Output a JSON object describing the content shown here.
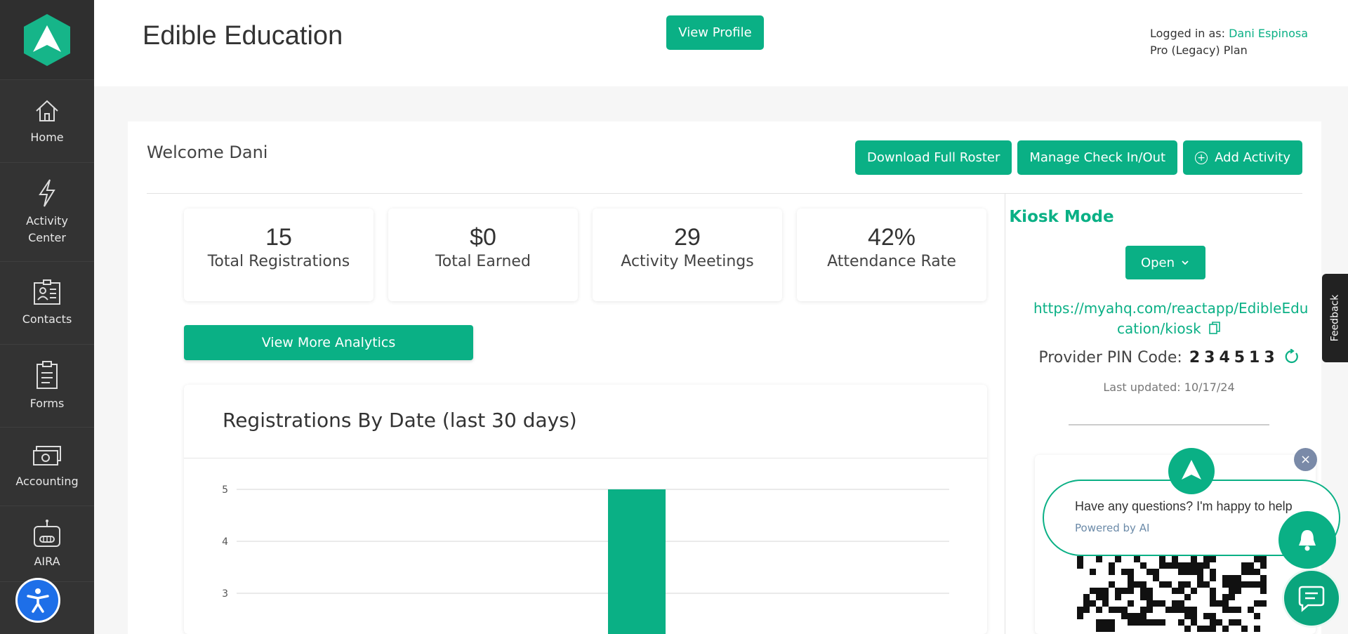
{
  "sidebar": {
    "items": [
      {
        "label": "Home",
        "icon": "home-icon"
      },
      {
        "label": "Activity\nCenter",
        "icon": "lightning-icon"
      },
      {
        "label": "Contacts",
        "icon": "contact-card-icon"
      },
      {
        "label": "Forms",
        "icon": "clipboard-icon"
      },
      {
        "label": "Accounting",
        "icon": "money-icon"
      },
      {
        "label": "AIRA",
        "icon": "robot-icon"
      }
    ]
  },
  "header": {
    "title": "Edible Education",
    "view_profile": "View Profile",
    "logged_in_prefix": "Logged in as: ",
    "user_name": "Dani Espinosa",
    "plan": "Pro (Legacy) Plan"
  },
  "main": {
    "welcome": "Welcome Dani",
    "buttons": {
      "download": "Download Full Roster",
      "manage": "Manage Check In/Out",
      "add": "Add Activity"
    },
    "stats": [
      {
        "value": "15",
        "label": "Total Registrations"
      },
      {
        "value": "$0",
        "label": "Total Earned"
      },
      {
        "value": "29",
        "label": "Activity Meetings"
      },
      {
        "value": "42%",
        "label": "Attendance Rate"
      }
    ],
    "analytics_button": "View More Analytics",
    "chart_title": "Registrations By Date (last 30 days)"
  },
  "kiosk": {
    "title": "Kiosk Mode",
    "open_label": "Open",
    "url_line1": "https://myahq.com/reactapp/EdibleEdu",
    "url_line2": "cation/kiosk",
    "pin_label": "Provider PIN Code:",
    "pin": "234513",
    "updated": "Last updated: 10/17/24"
  },
  "feedback": "Feedback",
  "chat": {
    "message": "Have any questions? I'm happy to help",
    "powered": "Powered by AI"
  },
  "colors": {
    "accent": "#0ab085",
    "sidebar": "#333333"
  },
  "chart_data": {
    "type": "bar",
    "title": "Registrations By Date (last 30 days)",
    "y_ticks": [
      3,
      4,
      5
    ],
    "ylim": [
      2.6,
      5
    ],
    "bars": [
      {
        "value": 5
      }
    ]
  }
}
